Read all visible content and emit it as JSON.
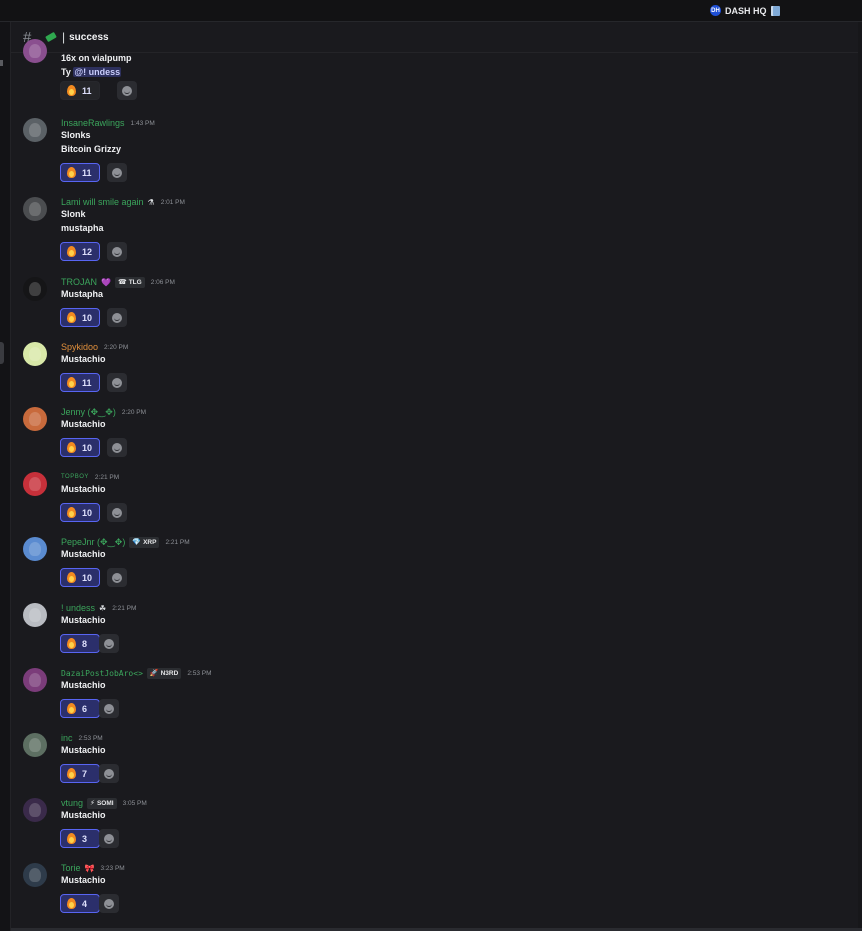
{
  "topbar": {
    "server_name": "DASH HQ",
    "server_icon_letters": "DH"
  },
  "channel": {
    "separator": "|",
    "name": "success"
  },
  "top_snippet": {
    "line1": "16x on vialpump",
    "line2_prefix": "Ty ",
    "line2_mention": "@! undess",
    "reaction_count": "11"
  },
  "messages": [
    {
      "username": "InsaneRawlings",
      "time": "1:43 PM",
      "lines": [
        "Slonks",
        "Bitcoin Grizzy"
      ],
      "count": "11",
      "color": "#3ba55c",
      "avatar": "#5b6166"
    },
    {
      "username": "Lami will smile again",
      "time": "2:01 PM",
      "lines": [
        "Slonk",
        "mustapha"
      ],
      "count": "12",
      "color": "#3ba55c",
      "avatar": "#4b4d50"
    },
    {
      "username": "TROJAN",
      "time": "2:06 PM",
      "tag": "TLG",
      "lines": [
        "Mustapha"
      ],
      "count": "10",
      "color": "#3ba55c",
      "avatar": "#151517"
    },
    {
      "username": "Spykidoo",
      "time": "2:20 PM",
      "lines": [
        "Mustachio"
      ],
      "count": "11",
      "color": "#e08f3c",
      "avatar": "#d8e8a8"
    },
    {
      "username": "Jenny (✥‿✥)",
      "time": "2:20 PM",
      "lines": [
        "Mustachio"
      ],
      "count": "10",
      "color": "#3ba55c",
      "avatar": "#c86a3c"
    },
    {
      "username": "TOPBOY",
      "time": "2:21 PM",
      "lines": [
        "Mustachio"
      ],
      "count": "10",
      "color": "#3ba55c",
      "avatar": "#c7303a"
    },
    {
      "username": "PepeJnr (✥‿✥)",
      "time": "2:21 PM",
      "tag": "XRP",
      "lines": [
        "Mustachio"
      ],
      "count": "10",
      "color": "#3ba55c",
      "avatar": "#5a8bd0"
    },
    {
      "username": "! undess",
      "time": "2:21 PM",
      "lines": [
        "Mustachio"
      ],
      "count": "8",
      "color": "#3ba55c",
      "avatar": "#b9bcc2"
    },
    {
      "username": "DazaiPostJobAro<>",
      "time": "2:53 PM",
      "tag": "N3RD",
      "lines": [
        "Mustachio"
      ],
      "count": "6",
      "color": "#3ba55c",
      "avatar": "#7b3c7a"
    },
    {
      "username": "inc",
      "time": "2:53 PM",
      "lines": [
        "Mustachio"
      ],
      "count": "7",
      "color": "#3ba55c",
      "avatar": "#5d6f62"
    },
    {
      "username": "vtung",
      "time": "3:05 PM",
      "tag": "SOMI",
      "lines": [
        "Mustachio"
      ],
      "count": "3",
      "color": "#3ba55c",
      "avatar": "#3a2a4a"
    },
    {
      "username": "Torie",
      "time": "3:23 PM",
      "lines": [
        "Mustachio"
      ],
      "count": "4",
      "color": "#3ba55c",
      "avatar": "#2e3b4a"
    }
  ]
}
